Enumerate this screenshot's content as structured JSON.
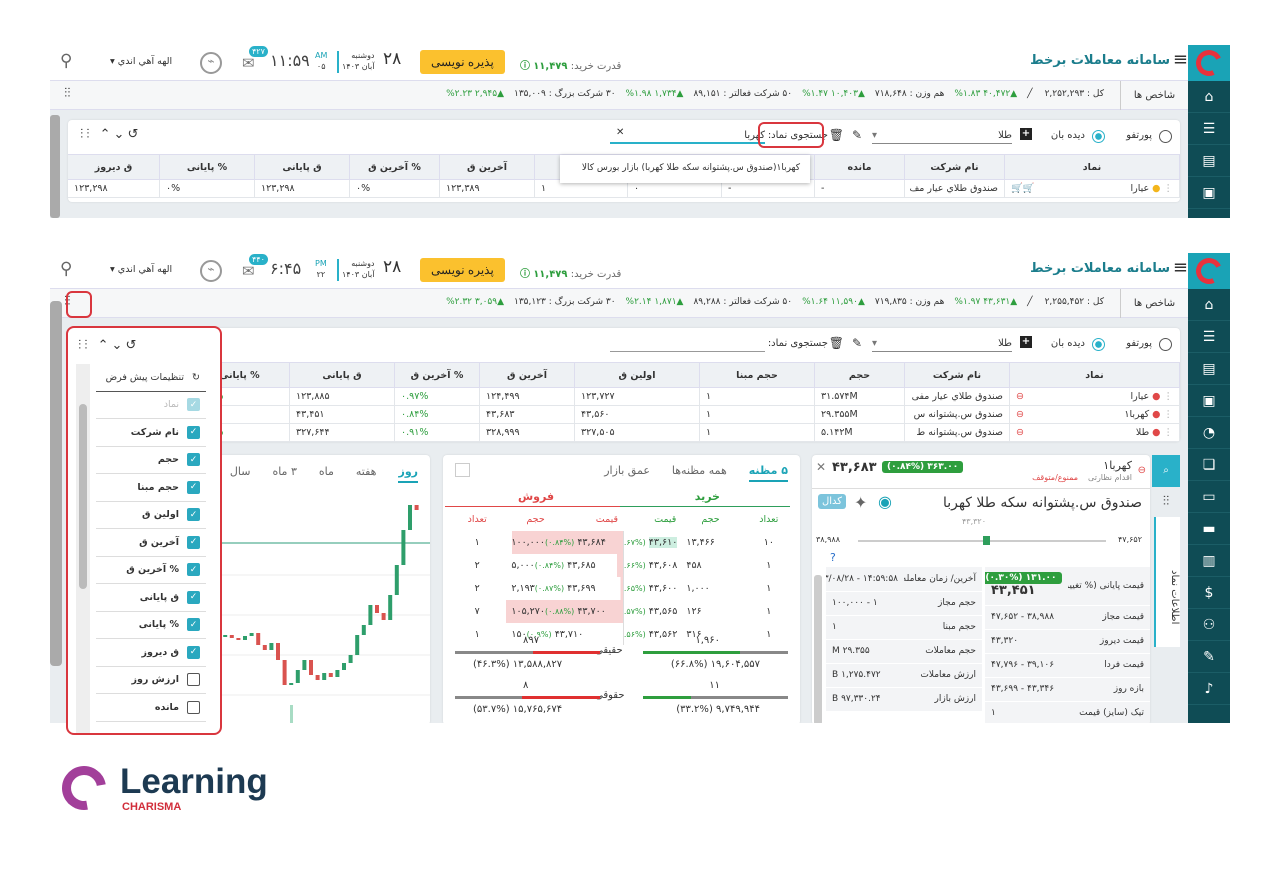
{
  "app": {
    "title": "سامانه معاملات برخط",
    "brand_color": "#1aa3b6",
    "sidebar_color": "#0f4c55",
    "accent_red": "#d9363e"
  },
  "sidebar_icons": [
    "home-icon",
    "list-icon",
    "book-icon",
    "briefcase-icon",
    "pie-chart-icon",
    "reader-icon",
    "id-card-icon",
    "credit-card-icon",
    "receipt-icon",
    "dollar-icon",
    "user-plus-icon",
    "edit-icon",
    "bell-icon"
  ],
  "screens": [
    {
      "header": {
        "buying_power_label": "قدرت خرید:",
        "buying_power": "۱۱,۴۷۹",
        "order_button": "پذیره نویسی",
        "day": "۲۸",
        "weekday": "دوشنبه",
        "month_year": "آبان ۱۴۰۳",
        "ampm": "AM",
        "seconds": "۰۵",
        "time": "۱۱:۵۹",
        "messages": "۴۲۷",
        "user": "الهه آهي اندي"
      },
      "indices": {
        "label": "شاخص ها",
        "items": [
          {
            "name": "کل : ۲,۲۵۲,۲۹۳",
            "change": "▲۴۰,۴۷۲ ۱.۸۳%"
          },
          {
            "name": "هم وزن : ۷۱۸,۶۴۸",
            "change": "▲۱۰,۴۰۳ ۱.۴۷%"
          },
          {
            "name": "۵۰ شرکت فعالتر : ۸۹,۱۵۱",
            "change": "▲۱,۷۳۴ ۱.۹۸%"
          },
          {
            "name": "۳۰ شرکت بزرگ : ۱۳۵,۰۰۹",
            "change": "▲۲,۹۴۵ ۲.۲۳%"
          }
        ]
      },
      "toolbar": {
        "portfolio": "پورتفو",
        "watchlist": "دیده بان",
        "list": "طلا",
        "search_label": "جستجوی نماد:",
        "search_value": "کهربا",
        "suggestion": "کهربا۱(صندوق س.پشتوانه سکه طلا کهربا)  بازار بورس کالا"
      },
      "columns": [
        "نماد",
        "نام شرکت",
        "مانده",
        "ارزش روز",
        "",
        "",
        "آخرین ق",
        "% آخرین ق",
        "ق پایانی",
        "% پایانی",
        "ق دیروز"
      ],
      "rows": [
        [
          "عیارا",
          "صندوق طلاي عيار مف",
          "-",
          "-",
          "۰",
          "۱",
          "۱۲۳,۳۸۹",
          "۰%",
          "۱۲۳,۲۹۸",
          "۰%",
          "۱۲۳,۲۹۸"
        ]
      ]
    },
    {
      "header": {
        "buying_power_label": "قدرت خرید:",
        "buying_power": "۱۱,۴۷۹",
        "order_button": "پذیره نویسی",
        "day": "۲۸",
        "weekday": "دوشنبه",
        "month_year": "آبان ۱۴۰۳",
        "ampm": "PM",
        "seconds": "۲۲",
        "time": "۶:۴۵",
        "messages": "۴۴۰",
        "user": "الهه آهي اندي"
      },
      "indices": {
        "label": "شاخص ها",
        "items": [
          {
            "name": "کل : ۲,۲۵۵,۴۵۲",
            "change": "▲۴۳,۶۳۱ ۱.۹۷%"
          },
          {
            "name": "هم وزن : ۷۱۹,۸۳۵",
            "change": "▲۱۱,۵۹۰ ۱.۶۴%"
          },
          {
            "name": "۵۰ شرکت فعالتر : ۸۹,۲۸۸",
            "change": "▲۱,۸۷۱ ۲.۱۴%"
          },
          {
            "name": "۳۰ شرکت بزرگ : ۱۳۵,۱۲۳",
            "change": "▲۳,۰۵۹ ۲.۳۲%"
          }
        ]
      },
      "toolbar": {
        "portfolio": "پورتفو",
        "watchlist": "دیده بان",
        "list": "طلا",
        "search_label": "جستجوی نماد:",
        "search_value": ""
      },
      "columns": [
        "نماد",
        "نام شرکت",
        "حجم",
        "حجم مبنا",
        "اولین ق",
        "آخرین ق",
        "% آخرین ق",
        "ق پایانی",
        "% پایانی"
      ],
      "rows": [
        [
          "عیارا",
          "صندوق طلاي عيار مفی",
          "۳۱.۵۷۴M",
          "۱",
          "۱۲۳,۷۲۷",
          "۱۲۴,۴۹۹",
          "۰.۹۷%",
          "۱۲۳,۸۸۵",
          "۰.۴۸%"
        ],
        [
          "کهربا۱",
          "صندوق س.پشتوانه س",
          "۲۹.۳۵۵M",
          "۱",
          "۴۳,۵۶۰",
          "۴۳,۶۸۳",
          "۰.۸۴%",
          "۴۳,۴۵۱",
          "۰.۳%"
        ],
        [
          "طلا",
          "صندوق س.پشتوانه ط",
          "۵.۱۴۲M",
          "۱",
          "۳۲۷,۵۰۵",
          "۳۲۸,۹۹۹",
          "۰.۹۱%",
          "۳۲۷,۶۴۴",
          "۰.۴۹%"
        ]
      ]
    }
  ],
  "column_menu": {
    "reset": "تنظیمات پیش فرض",
    "items": [
      {
        "label": "نماد",
        "checked": true,
        "disabled": true
      },
      {
        "label": "نام شرکت",
        "checked": true
      },
      {
        "label": "حجم",
        "checked": true
      },
      {
        "label": "حجم مبنا",
        "checked": true
      },
      {
        "label": "اولین ق",
        "checked": true
      },
      {
        "label": "آخرین ق",
        "checked": true
      },
      {
        "label": "% آخرین ق",
        "checked": true
      },
      {
        "label": "ق پایانی",
        "checked": true
      },
      {
        "label": "% پایانی",
        "checked": true
      },
      {
        "label": "ق دیروز",
        "checked": true
      },
      {
        "label": "ارزش روز",
        "checked": false
      },
      {
        "label": "مانده",
        "checked": false
      }
    ]
  },
  "chart": {
    "tabs": [
      "روز",
      "هفته",
      "ماه",
      "۳ ماه",
      "سال"
    ],
    "active": "روز"
  },
  "orderbook": {
    "tabs": [
      "۵ مظنه",
      "همه مظنه‌ها",
      "عمق بازار"
    ],
    "active": "۵ مظنه",
    "buy_label": "خرید",
    "sell_label": "فروش",
    "buy_headers": [
      "تعداد",
      "حجم",
      "قیمت"
    ],
    "sell_headers": [
      "قیمت",
      "حجم",
      "تعداد"
    ],
    "buy": [
      {
        "count": "۱۰",
        "volume": "۱۳,۴۶۶",
        "price": "۴۳,۶۱۰",
        "pct": "(۰.۶۷%)"
      },
      {
        "count": "۱",
        "volume": "۴۵۸",
        "price": "۴۳,۶۰۸",
        "pct": "(۰.۶۶%)"
      },
      {
        "count": "۱",
        "volume": "۱,۰۰۰",
        "price": "۴۳,۶۰۰",
        "pct": "(۰.۶۵%)"
      },
      {
        "count": "۱",
        "volume": "۱۲۶",
        "price": "۴۳,۵۶۵",
        "pct": "(۰.۵۷%)"
      },
      {
        "count": "۱",
        "volume": "۳۱۶",
        "price": "۴۳,۵۶۲",
        "pct": "(۰.۵۶%)"
      }
    ],
    "sell": [
      {
        "price": "۴۳,۶۸۴",
        "pct": "(۰.۸۴%)",
        "volume": "۱۰۰,۰۰۰",
        "count": "۱",
        "depth": 0.95
      },
      {
        "price": "۴۳,۶۸۵",
        "pct": "(۰.۸۴%)",
        "volume": "۵,۰۰۰",
        "count": "۲",
        "depth": 0.05
      },
      {
        "price": "۴۳,۶۹۹",
        "pct": "(۰.۸۷%)",
        "volume": "۲,۱۹۳",
        "count": "۲",
        "depth": 0.02
      },
      {
        "price": "۴۳,۷۰۰",
        "pct": "(۰.۸۸%)",
        "volume": "۱۰۵,۲۷۰",
        "count": "۷",
        "depth": 1
      },
      {
        "price": "۴۳,۷۱۰",
        "pct": "(۰.۹%)",
        "volume": "۱۵۰",
        "count": "۱",
        "depth": 0
      }
    ],
    "traders": [
      {
        "label": "حقیقی",
        "buy_count": "۱,۹۶۰",
        "sell_count": "۸۹۷",
        "buy_volume": "۱۹,۶۰۴,۵۵۷ (۶۶.۸%)",
        "sell_volume": "۱۳,۵۸۸,۸۲۷ (۴۶.۳%)",
        "buy_share": 0.668,
        "sell_share": 0.463
      },
      {
        "label": "حقوقی",
        "buy_count": "۱۱",
        "sell_count": "۸",
        "buy_volume": "۹,۷۴۹,۹۴۴ (۳۳.۲%)",
        "sell_volume": "۱۵,۷۶۵,۶۷۴ (۵۳.۷%)",
        "buy_share": 0.332,
        "sell_share": 0.537
      }
    ]
  },
  "symbol": {
    "code": "کهربا۱",
    "status_label": "اقدام نظارتی",
    "status": "ممنوع/متوقف",
    "price": "۴۳,۶۸۳",
    "change": "۳۶۳.۰۰ (۰.۸۴%)",
    "name": "صندوق س.پشتوانه سکه طلا کهربا",
    "codal": "کدال",
    "range_min": "۳۸,۹۸۸",
    "range_max": "۴۷,۶۵۲",
    "reference": "۴۳,۳۲۰",
    "tab": "اطلاعات نماد",
    "right": [
      {
        "label": "قیمت پایانی (% تغییر)",
        "value": "۴۳,۴۵۱",
        "badge": "۱۳۱.۰۰ (۰.۳۰%)"
      },
      {
        "label": "قیمت مجاز",
        "value": "۳۸,۹۸۸ - ۴۷,۶۵۲"
      },
      {
        "label": "قیمت دیروز",
        "value": "۴۳,۳۲۰"
      },
      {
        "label": "قیمت فردا",
        "value": "۳۹,۱۰۶ - ۴۷,۷۹۶"
      },
      {
        "label": "بازه روز",
        "value": "۴۳,۳۴۶ - ۴۳,۶۹۹"
      },
      {
        "label": "تیک (سایز) قیمت",
        "value": "۱"
      }
    ],
    "left": [
      {
        "label": "آخرین/ زمان معامله",
        "value": "۱۴:۵۹:۵۸ - ۱۴۰۳/۰۸/۲۸"
      },
      {
        "label": "حجم مجاز",
        "value": "۱ - ۱۰۰,۰۰۰"
      },
      {
        "label": "حجم مبنا",
        "value": "۱"
      },
      {
        "label": "حجم معاملات",
        "value": "۲۹.۳۵۵ M"
      },
      {
        "label": "ارزش معاملات",
        "value": "۱,۲۷۵.۴۷۲ B"
      },
      {
        "label": "ارزش بازار",
        "value": "۹۷,۳۳۰.۲۴ B"
      }
    ]
  },
  "footer_logo": {
    "word": "Learning",
    "sub": "CHARISMA"
  }
}
